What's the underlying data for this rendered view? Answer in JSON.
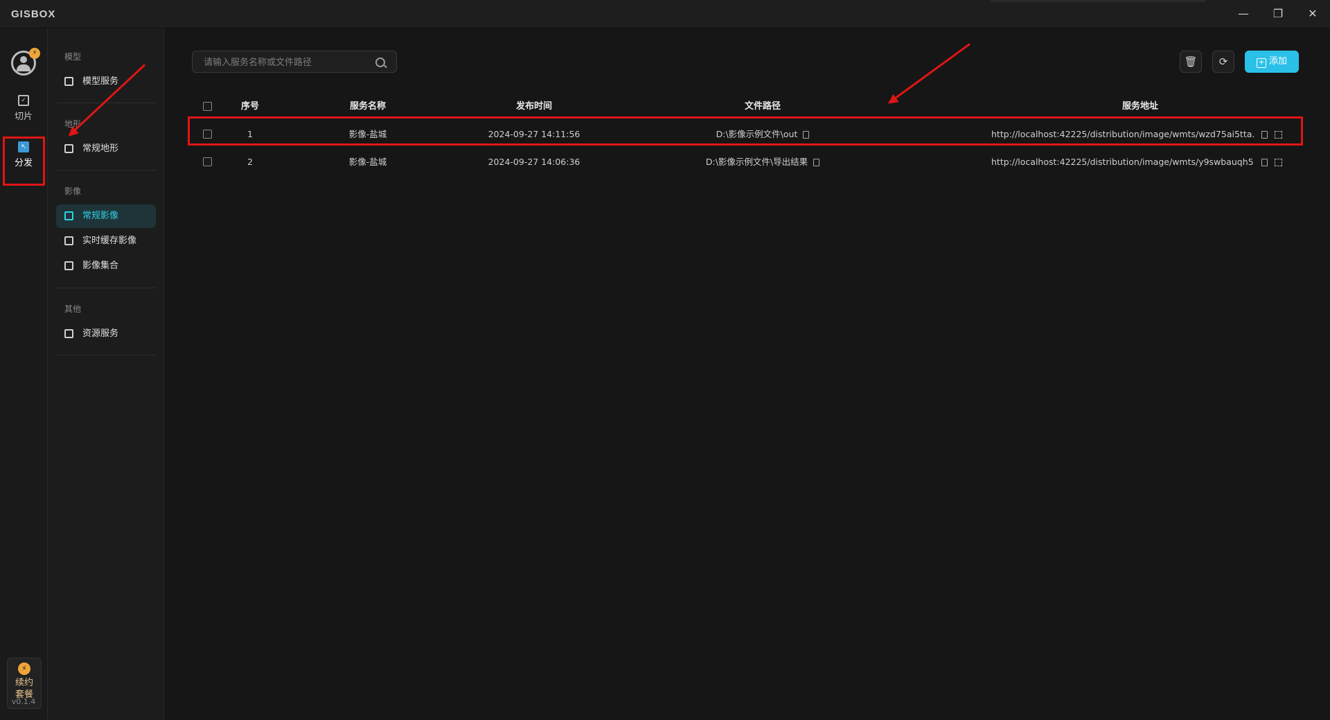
{
  "app": {
    "logo": "GISBOX"
  },
  "window": {
    "minimize": "—",
    "restore": "❐",
    "close": "✕"
  },
  "rail": {
    "items": [
      {
        "label": "切片",
        "icon": "slice-icon"
      },
      {
        "label": "分发",
        "icon": "distribute-icon",
        "active": true
      }
    ],
    "renew_line1": "续约",
    "renew_line2": "套餐",
    "version": "v0.1.4"
  },
  "subnav": {
    "groups": [
      {
        "label": "模型",
        "items": [
          {
            "label": "模型服务"
          }
        ]
      },
      {
        "label": "地形",
        "items": [
          {
            "label": "常规地形"
          }
        ]
      },
      {
        "label": "影像",
        "items": [
          {
            "label": "常规影像",
            "active": true
          },
          {
            "label": "实时缓存影像"
          },
          {
            "label": "影像集合"
          }
        ]
      },
      {
        "label": "其他",
        "items": [
          {
            "label": "资源服务"
          }
        ]
      }
    ]
  },
  "toolbar": {
    "search_placeholder": "请输入服务名称或文件路径",
    "add_label": "添加"
  },
  "table": {
    "headers": {
      "index": "序号",
      "name": "服务名称",
      "time": "发布时间",
      "path": "文件路径",
      "url": "服务地址"
    },
    "rows": [
      {
        "index": "1",
        "name": "影像-盐城",
        "time": "2024-09-27 14:11:56",
        "path": "D:\\影像示例文件\\out",
        "url": "http://localhost:42225/distribution/image/wmts/wzd75ai5tta..."
      },
      {
        "index": "2",
        "name": "影像-盐城",
        "time": "2024-09-27 14:06:36",
        "path": "D:\\影像示例文件\\导出结果",
        "url": "http://localhost:42225/distribution/image/wmts/y9swbauqh5..."
      }
    ]
  },
  "colors": {
    "accent": "#2bc0e8",
    "annotation": "#e01515",
    "active_nav_bg": "#1e3438",
    "active_nav_text": "#2fd2e8"
  }
}
